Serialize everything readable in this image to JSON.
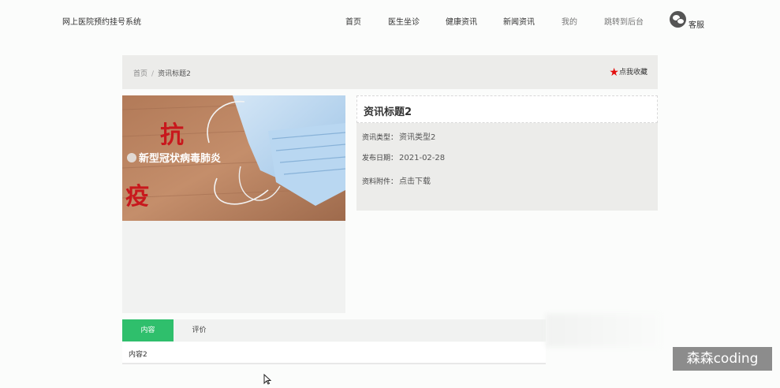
{
  "header": {
    "brand": "网上医院预约挂号系统",
    "nav": [
      "首页",
      "医生坐诊",
      "健康资讯",
      "新闻资讯",
      "我的",
      "跳转到后台"
    ],
    "service_label": "客服"
  },
  "breadcrumb": {
    "home": "首页",
    "separator": "/",
    "current": "资讯标题2",
    "favorite_label": "点我收藏"
  },
  "image_panel": {
    "overlay_text": "新型冠状病毒肺炎",
    "calligraphy": [
      "抗",
      "疫"
    ]
  },
  "detail": {
    "title": "资讯标题2",
    "fields": [
      {
        "label": "资讯类型：",
        "value": "资讯类型2"
      },
      {
        "label": "发布日期：",
        "value": "2021-02-28"
      },
      {
        "label": "资料附件：",
        "value": "点击下载"
      }
    ]
  },
  "tabs": {
    "items": [
      "内容",
      "评价"
    ],
    "active_index": 0
  },
  "content_text": "内容2",
  "watermark": "森森coding",
  "colors": {
    "accent_green": "#2fbf6c",
    "star_red": "#e30e0e"
  }
}
